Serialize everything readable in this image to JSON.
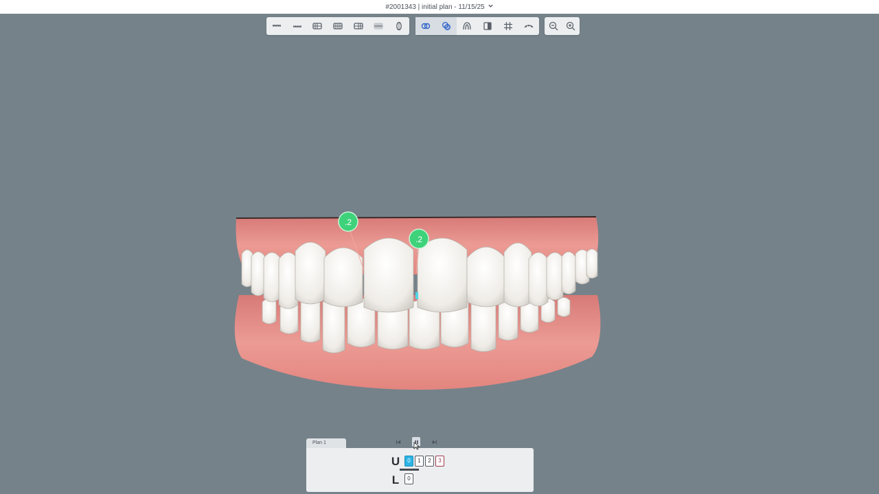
{
  "header": {
    "title": "#2001343 | initial plan - 11/15/25",
    "dropdown_icon": "chevron-down-icon"
  },
  "toolbars": {
    "views": [
      {
        "icon": "view-upper-front-icon"
      },
      {
        "icon": "view-lower-front-icon"
      },
      {
        "icon": "view-right-icon"
      },
      {
        "icon": "view-front-icon"
      },
      {
        "icon": "view-left-icon"
      },
      {
        "icon": "view-back-icon"
      },
      {
        "icon": "view-occlusal-icon"
      }
    ],
    "display": [
      {
        "icon": "superimpose-icon",
        "active": true
      },
      {
        "icon": "overlay-icon",
        "active": true
      },
      {
        "icon": "tooth-icon",
        "active": false
      },
      {
        "icon": "split-view-icon",
        "active": false
      },
      {
        "icon": "grid-icon",
        "active": false
      },
      {
        "icon": "attachments-icon",
        "active": false
      }
    ],
    "zoom": [
      {
        "icon": "zoom-out-icon"
      },
      {
        "icon": "zoom-in-icon"
      }
    ]
  },
  "viewport": {
    "markers": [
      {
        "label": ".2"
      },
      {
        "label": ".2"
      }
    ],
    "colors": {
      "gum": "#e58a86",
      "tooth": "#f2f0ec",
      "marker": "#3ed27a",
      "background": "#75828a"
    }
  },
  "plan": {
    "tab_label": "Plan 1",
    "playback": [
      "skip-back-icon",
      "pause-icon",
      "skip-forward-icon"
    ],
    "upper": {
      "label": "U",
      "stages": [
        "0",
        "1",
        "2",
        "3"
      ],
      "current_index": 0
    },
    "lower": {
      "label": "L",
      "stages": [
        "0"
      ]
    }
  }
}
